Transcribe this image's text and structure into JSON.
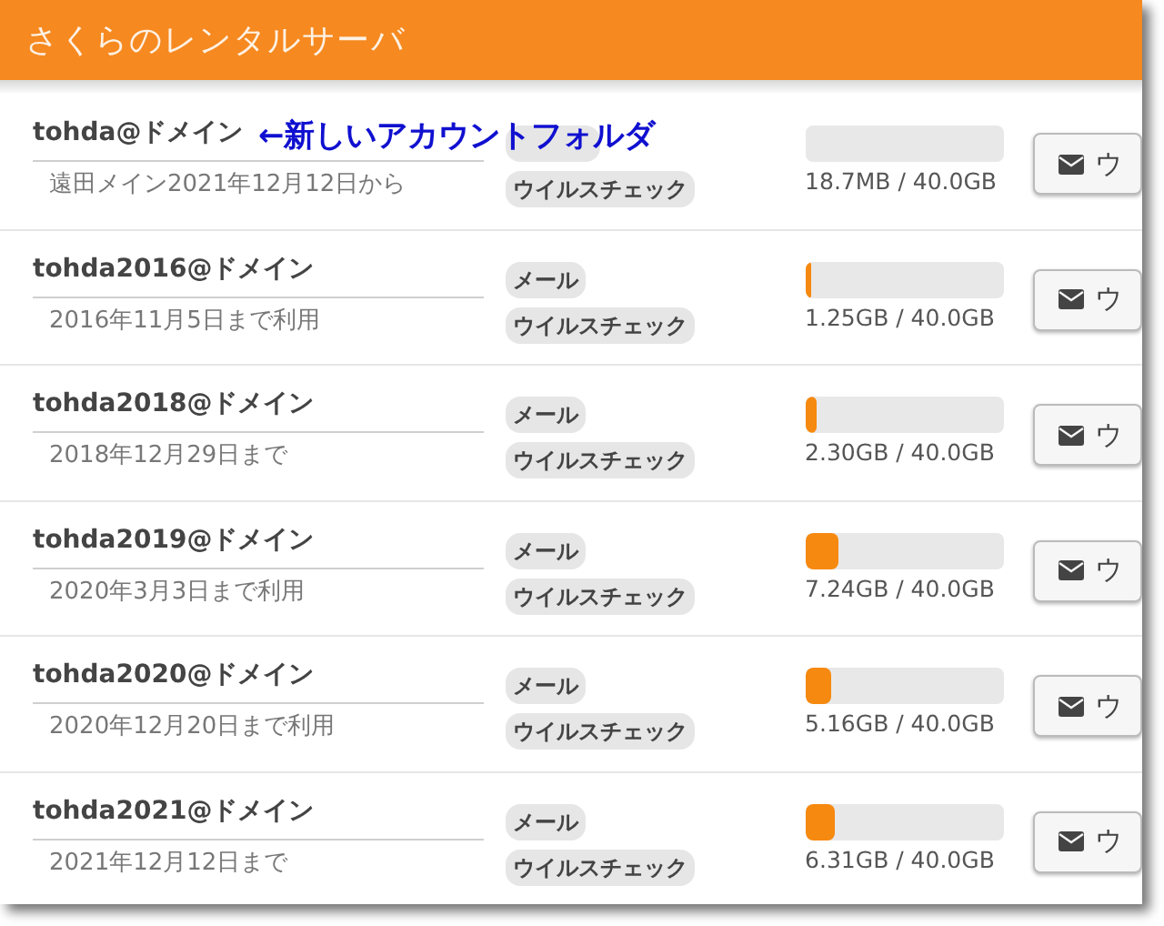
{
  "header": {
    "title": "さくらのレンタルサーバ"
  },
  "annotation": "←新しいアカウントフォルダ",
  "accounts": [
    {
      "name": "tohda@ドメイン",
      "note": "遠田メイン2021年12月12日から",
      "tags": [
        {
          "covered": true
        },
        {
          "label": "ウイルスチェック",
          "covered": false
        }
      ],
      "level": 0.0005,
      "reading": "18.7MB / 40.0GB",
      "button": "ウ"
    },
    {
      "name": "tohda2016@ドメイン",
      "note": "2016年11月5日まで利用",
      "tags": [
        {
          "label": "メール",
          "covered": false
        },
        {
          "label": "ウイルスチェック",
          "covered": false
        }
      ],
      "level": 0.031,
      "reading": "1.25GB / 40.0GB",
      "button": "ウ"
    },
    {
      "name": "tohda2018@ドメイン",
      "note": "2018年12月29日まで",
      "tags": [
        {
          "label": "メール",
          "covered": false
        },
        {
          "label": "ウイルスチェック",
          "covered": false
        }
      ],
      "level": 0.058,
      "reading": "2.30GB / 40.0GB",
      "button": "ウ"
    },
    {
      "name": "tohda2019@ドメイン",
      "note": "2020年3月3日まで利用",
      "tags": [
        {
          "label": "メール",
          "covered": false
        },
        {
          "label": "ウイルスチェック",
          "covered": false
        }
      ],
      "level": 0.17,
      "reading": "7.24GB / 40.0GB",
      "button": "ウ"
    },
    {
      "name": "tohda2020@ドメイン",
      "note": "2020年12月20日まで利用",
      "tags": [
        {
          "label": "メール",
          "covered": false
        },
        {
          "label": "ウイルスチェック",
          "covered": false
        }
      ],
      "level": 0.13,
      "reading": "5.16GB / 40.0GB",
      "button": "ウ"
    },
    {
      "name": "tohda2021@ドメイン",
      "note": "2021年12月12日まで",
      "tags": [
        {
          "label": "メール",
          "covered": false
        },
        {
          "label": "ウイルスチェック",
          "covered": false
        }
      ],
      "level": 0.15,
      "reading": "6.31GB / 40.0GB",
      "button": "ウ"
    }
  ]
}
